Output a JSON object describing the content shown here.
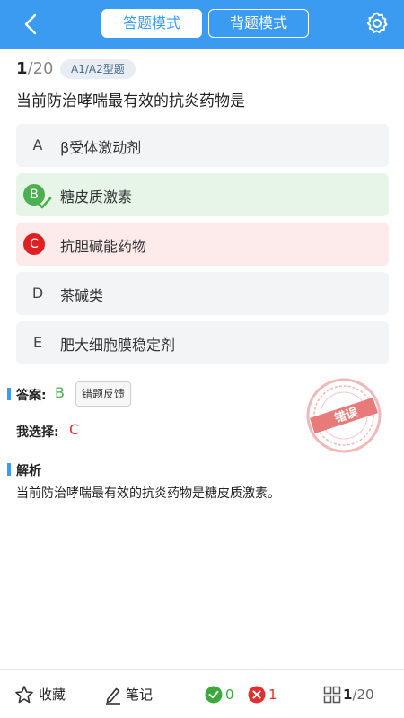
{
  "header": {
    "tabs": [
      {
        "label": "答题模式",
        "active": true
      },
      {
        "label": "背题模式",
        "active": false
      }
    ],
    "accent_color": "#3a9bf0"
  },
  "question": {
    "current": "1",
    "total": "/20",
    "type": "A1/A2型题",
    "stem": "当前防治哮喘最有效的抗炎药物是",
    "options": [
      {
        "letter": "A",
        "text": "β受体激动剂",
        "state": "normal"
      },
      {
        "letter": "B",
        "text": "糖皮质激素",
        "state": "correct"
      },
      {
        "letter": "C",
        "text": "抗胆碱能药物",
        "state": "wrong"
      },
      {
        "letter": "D",
        "text": "茶碱类",
        "state": "normal"
      },
      {
        "letter": "E",
        "text": "肥大细胞膜稳定剂",
        "state": "normal"
      }
    ]
  },
  "result": {
    "answer_label": "答案:",
    "answer_value": "B",
    "feedback_label": "错题反馈",
    "my_label": "我选择:",
    "my_value": "C",
    "stamp_text": "错误"
  },
  "analysis": {
    "label": "解析",
    "text": "当前防治哮喘最有效的抗炎药物是糖皮质激素。"
  },
  "footer": {
    "favorite_label": "收藏",
    "note_label": "笔记",
    "correct_count": "0",
    "wrong_count": "1",
    "progress_current": "1",
    "progress_total": "/20"
  },
  "icons": [
    "back-chevron-icon",
    "gear-icon",
    "check-icon",
    "star-icon",
    "pencil-icon",
    "correct-circle-icon",
    "wrong-circle-icon",
    "grid-icon"
  ]
}
